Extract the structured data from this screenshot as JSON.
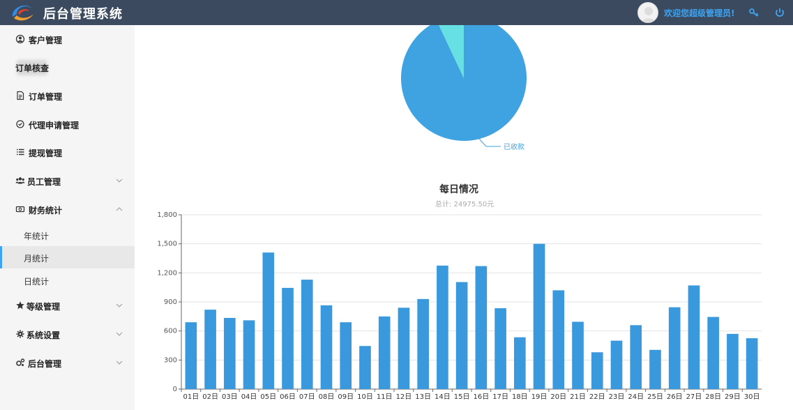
{
  "header": {
    "title": "后台管理系统",
    "welcome": "欢迎您超级管理员!",
    "accent": "#3ea3f0",
    "bg": "#3c4a5f"
  },
  "sidebar": {
    "items": [
      {
        "label": "客户管理",
        "icon": "user-circle-icon"
      },
      {
        "label": "订单核查",
        "icon": "redacted-icon"
      },
      {
        "label": "订单管理",
        "icon": "document-icon"
      },
      {
        "label": "代理申请管理",
        "icon": "check-circle-icon"
      },
      {
        "label": "提现管理",
        "icon": "list-icon"
      },
      {
        "label": "员工管理",
        "icon": "users-icon",
        "expandable": true
      },
      {
        "label": "财务统计",
        "icon": "money-icon",
        "expandable": true,
        "expanded": true
      },
      {
        "label": "等级管理",
        "icon": "star-icon",
        "expandable": true
      },
      {
        "label": "系统设置",
        "icon": "gear-icon",
        "expandable": true
      },
      {
        "label": "后台管理",
        "icon": "gears-icon",
        "expandable": true
      }
    ],
    "finance_sub": [
      {
        "label": "年统计"
      },
      {
        "label": "月统计",
        "active": true
      },
      {
        "label": "日统计"
      }
    ]
  },
  "pie": {
    "label": "已收款",
    "colors": [
      "#3ea3e0",
      "#67e0e3"
    ],
    "small_slice_fraction": 0.07
  },
  "chart_data": {
    "type": "bar",
    "title": "每日情况",
    "subtitle": "总计: 24975.50元",
    "categories": [
      "01日",
      "02日",
      "03日",
      "04日",
      "05日",
      "06日",
      "07日",
      "08日",
      "09日",
      "10日",
      "11日",
      "12日",
      "13日",
      "14日",
      "15日",
      "16日",
      "17日",
      "18日",
      "19日",
      "20日",
      "21日",
      "22日",
      "23日",
      "24日",
      "25日",
      "26日",
      "27日",
      "28日",
      "29日",
      "30日"
    ],
    "values": [
      690,
      820,
      735,
      710,
      1410,
      1045,
      1130,
      865,
      690,
      445,
      750,
      840,
      930,
      1275,
      1105,
      1270,
      835,
      535,
      1500,
      1020,
      695,
      380,
      500,
      660,
      405,
      845,
      1070,
      745,
      570,
      525
    ],
    "ylim": [
      0,
      1800
    ],
    "yticks": [
      0,
      300,
      600,
      900,
      1200,
      1500,
      1800
    ],
    "ytick_labels": [
      "0",
      "300",
      "600",
      "900",
      "1,200",
      "1,500",
      "1,800"
    ],
    "grid": true,
    "color": "#3a99dc"
  }
}
